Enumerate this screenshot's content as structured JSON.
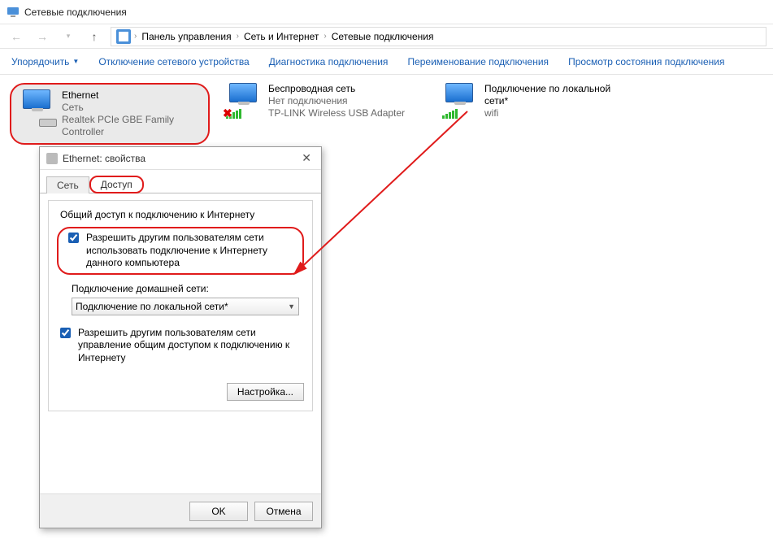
{
  "window": {
    "title": "Сетевые подключения"
  },
  "breadcrumb": {
    "items": [
      "Панель управления",
      "Сеть и Интернет",
      "Сетевые подключения"
    ]
  },
  "commands": {
    "organize": "Упорядочить",
    "disable": "Отключение сетевого устройства",
    "diagnose": "Диагностика подключения",
    "rename": "Переименование подключения",
    "status": "Просмотр состояния подключения"
  },
  "adapters": [
    {
      "name": "Ethernet",
      "status": "Сеть",
      "desc": "Realtek PCIe GBE Family Controller",
      "selected": true,
      "kind": "wired"
    },
    {
      "name": "Беспроводная сеть",
      "status": "Нет подключения",
      "desc": "TP-LINK Wireless USB Adapter",
      "selected": false,
      "kind": "wifi-off"
    },
    {
      "name": "Подключение по локальной сети*",
      "status": "wifi",
      "desc": "",
      "selected": false,
      "kind": "wifi-on"
    }
  ],
  "dialog": {
    "title": "Ethernet: свойства",
    "tabs": {
      "network": "Сеть",
      "sharing": "Доступ"
    },
    "group_title": "Общий доступ к подключению к Интернету",
    "chk1": "Разрешить другим пользователям сети использовать подключение к Интернету данного компьютера",
    "home_label": "Подключение домашней сети:",
    "home_value": "Подключение по локальной сети*",
    "chk2": "Разрешить другим пользователям сети управление общим доступом к подключению к Интернету",
    "settings_btn": "Настройка...",
    "ok": "OK",
    "cancel": "Отмена"
  }
}
